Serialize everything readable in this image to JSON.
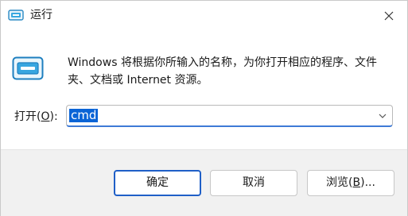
{
  "window": {
    "title": "运行",
    "app_icon": "run-dialog-icon",
    "close_icon": "close-icon"
  },
  "description": {
    "icon": "run-dialog-large-icon",
    "text": "Windows 将根据你所输入的名称，为你打开相应的程序、文件夹、文档或 Internet 资源。"
  },
  "open_field": {
    "label_prefix": "打开(",
    "label_accel": "O",
    "label_suffix": "):",
    "value": "cmd",
    "dropdown_icon": "chevron-down-icon"
  },
  "buttons": {
    "ok": "确定",
    "cancel": "取消",
    "browse_prefix": "浏览(",
    "browse_accel": "B",
    "browse_suffix": ")..."
  },
  "colors": {
    "accent": "#0a64d6",
    "footer_bg": "#f1f1f1"
  }
}
